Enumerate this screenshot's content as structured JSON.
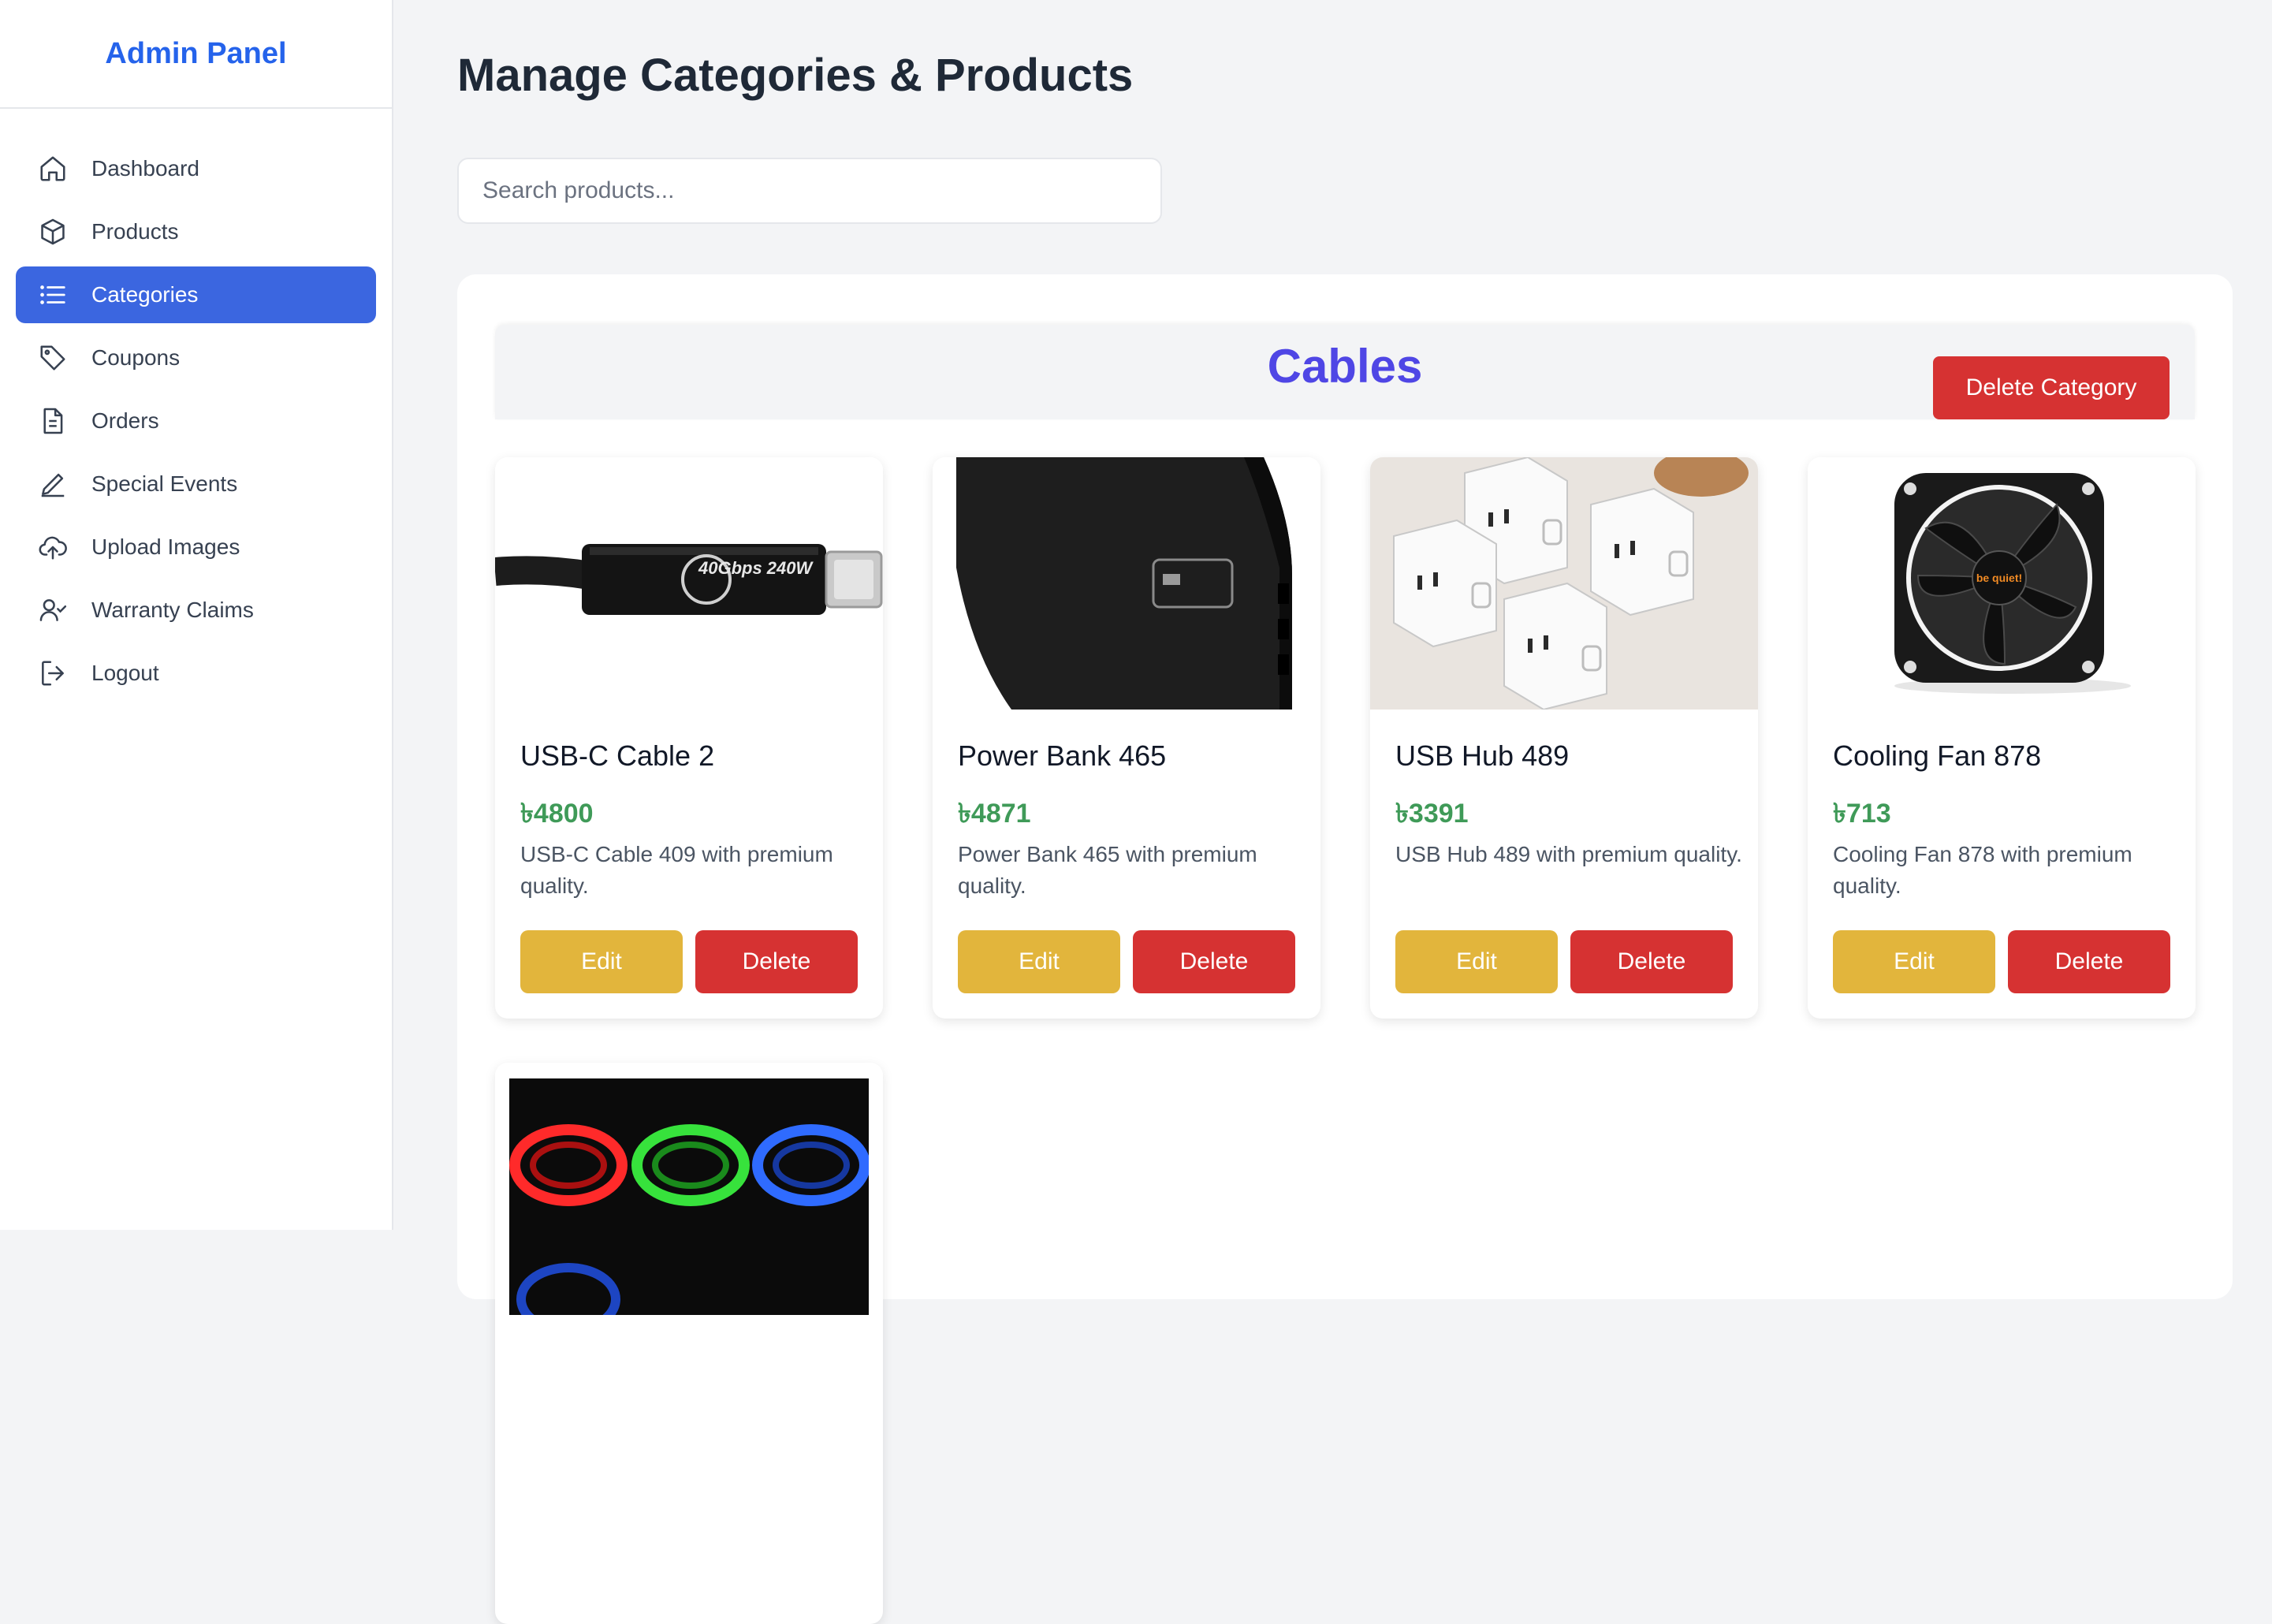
{
  "sidebar": {
    "brand": "Admin Panel",
    "items": [
      {
        "label": "Dashboard",
        "icon": "home-icon"
      },
      {
        "label": "Products",
        "icon": "box-icon"
      },
      {
        "label": "Categories",
        "icon": "list-icon",
        "active": true
      },
      {
        "label": "Coupons",
        "icon": "tag-icon"
      },
      {
        "label": "Orders",
        "icon": "document-icon"
      },
      {
        "label": "Special Events",
        "icon": "pencil-icon"
      },
      {
        "label": "Upload Images",
        "icon": "cloud-upload-icon"
      },
      {
        "label": "Warranty Claims",
        "icon": "user-check-icon"
      },
      {
        "label": "Logout",
        "icon": "logout-icon"
      }
    ],
    "active_color": "#3b66e0"
  },
  "main": {
    "title": "Manage Categories & Products",
    "search_placeholder": "Search products...",
    "category": {
      "name": "Cables",
      "delete_label": "Delete Category"
    },
    "products": [
      {
        "name": "USB-C Cable 2",
        "price": "৳4800",
        "description": "USB-C Cable 409 with premium quality.",
        "edit_label": "Edit",
        "delete_label": "Delete"
      },
      {
        "name": "Power Bank 465",
        "price": "৳4871",
        "description": "Power Bank 465 with premium quality.",
        "edit_label": "Edit",
        "delete_label": "Delete"
      },
      {
        "name": "USB Hub 489",
        "price": "৳3391",
        "description": "USB Hub 489 with premium quality.",
        "edit_label": "Edit",
        "delete_label": "Delete"
      },
      {
        "name": "Cooling Fan 878",
        "price": "৳713",
        "description": "Cooling Fan 878 with premium quality.",
        "edit_label": "Edit",
        "delete_label": "Delete"
      }
    ],
    "image_text": {
      "cable": "40Gbps 240W",
      "fan": "be quiet!"
    }
  },
  "colors": {
    "brand": "#2563eb",
    "category_title": "#4f46e5",
    "price": "#3f9a58",
    "edit": "#e2b53c",
    "delete": "#d63232"
  }
}
